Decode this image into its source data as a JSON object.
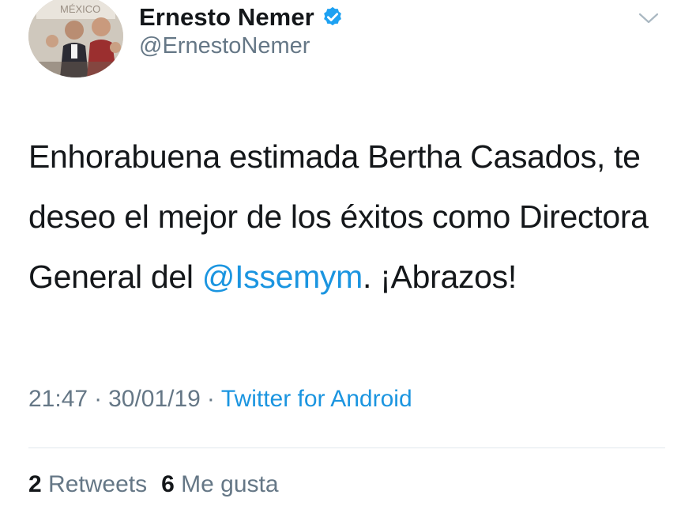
{
  "author": {
    "display_name": "Ernesto Nemer",
    "handle": "@ErnestoNemer",
    "verified": true,
    "avatar_sign_text": "MÉXICO"
  },
  "tweet": {
    "text_part1": "Enhorabuena estimada Bertha Casados, te deseo el mejor de los éxitos como Directora General del ",
    "mention": "@Issemym",
    "text_part2": ". ¡Abrazos!"
  },
  "meta": {
    "time": "21:47",
    "separator": "·",
    "date": "30/01/19",
    "source": "Twitter for Android"
  },
  "stats": {
    "retweets_count": "2",
    "retweets_label": "Retweets",
    "likes_count": "6",
    "likes_label": "Me gusta"
  },
  "colors": {
    "link": "#1b95e0",
    "secondary": "#657786",
    "primary_text": "#14171a",
    "verified": "#1da1f2"
  },
  "icons": [
    "verified-badge-icon",
    "chevron-down-icon"
  ]
}
